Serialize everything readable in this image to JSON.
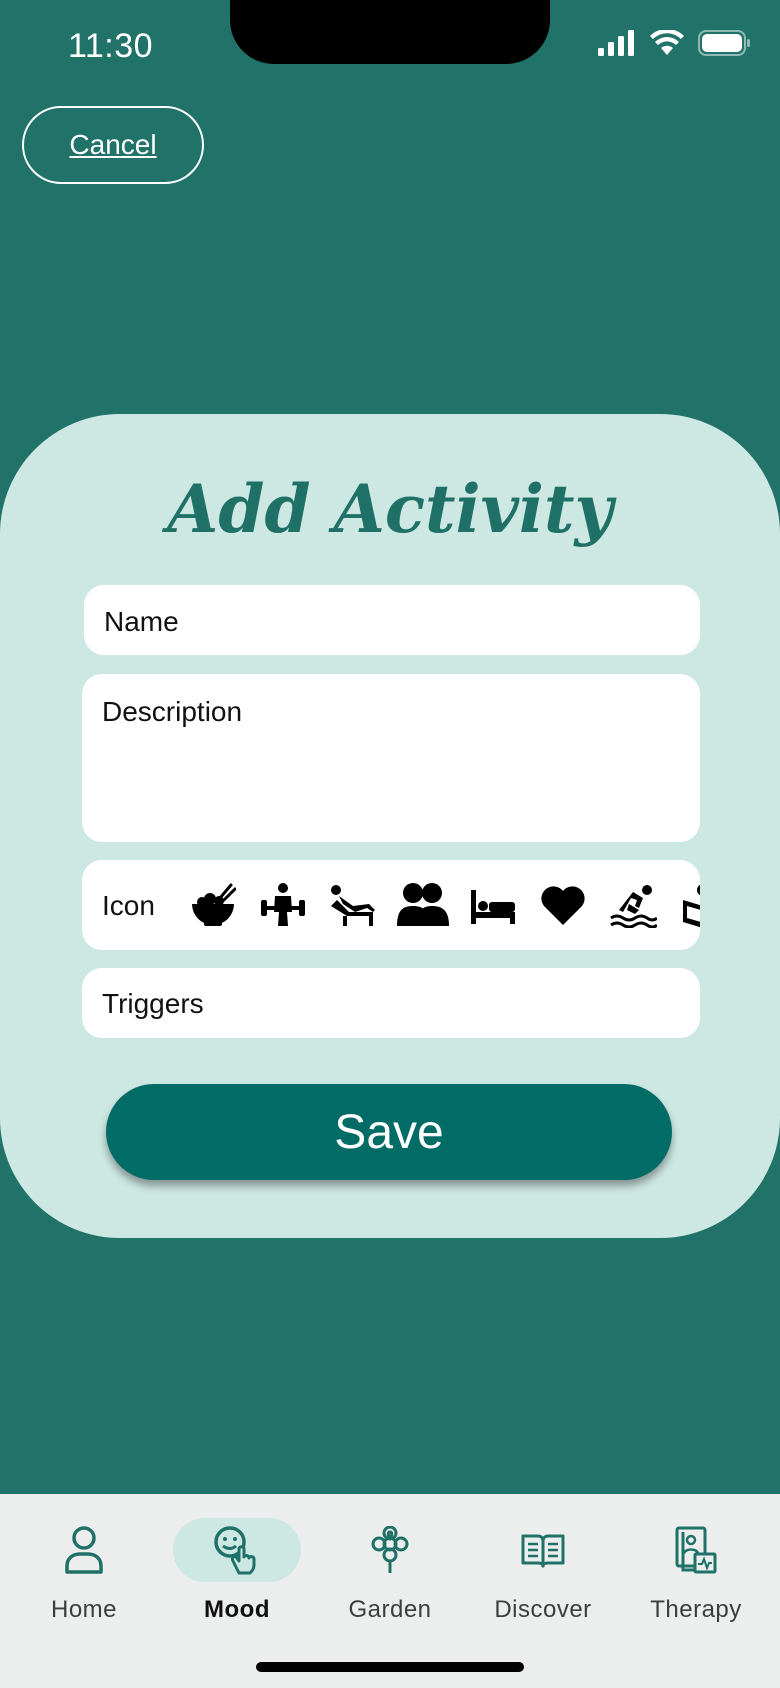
{
  "status_bar": {
    "time": "11:30",
    "icons": [
      "signal-icon",
      "wifi-icon",
      "battery-icon"
    ]
  },
  "header": {
    "cancel_label": "Cancel"
  },
  "form": {
    "title": "Add Activity",
    "name_placeholder": "Name",
    "description_placeholder": "Description",
    "icon_label": "Icon",
    "icon_options": [
      "food-bowl-icon",
      "weightlifting-icon",
      "relaxing-icon",
      "people-icon",
      "bed-icon",
      "heart-icon",
      "swimming-icon",
      "reading-icon"
    ],
    "triggers_placeholder": "Triggers",
    "save_label": "Save"
  },
  "tab_bar": {
    "active": "Mood",
    "tabs": [
      {
        "label": "Home",
        "icon": "person-icon"
      },
      {
        "label": "Mood",
        "icon": "mood-touch-icon"
      },
      {
        "label": "Garden",
        "icon": "flower-icon"
      },
      {
        "label": "Discover",
        "icon": "book-icon"
      },
      {
        "label": "Therapy",
        "icon": "therapy-doc-icon"
      }
    ]
  },
  "colors": {
    "background": "#21736a",
    "card": "#cde7e3",
    "primary": "#016b66",
    "title": "#1f7168",
    "tab_bar": "#eceeed"
  }
}
